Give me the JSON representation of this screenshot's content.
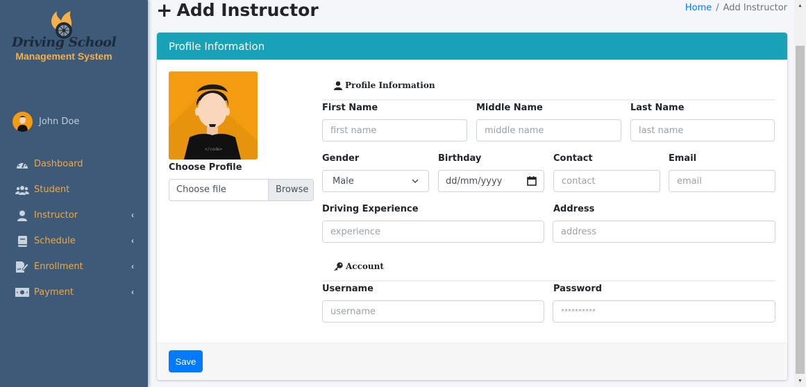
{
  "sidebar": {
    "brand": {
      "title": "Driving School",
      "subtitle": "Management System",
      "logo_icon": "flame-wheel-logo"
    },
    "user": {
      "name": "John Doe",
      "avatar_icon": "user-avatar"
    },
    "items": [
      {
        "label": "Dashboard",
        "icon": "tachometer-icon",
        "has_submenu": false
      },
      {
        "label": "Student",
        "icon": "users-icon",
        "has_submenu": false
      },
      {
        "label": "Instructor",
        "icon": "user-icon",
        "has_submenu": true
      },
      {
        "label": "Schedule",
        "icon": "book-icon",
        "has_submenu": true
      },
      {
        "label": "Enrollment",
        "icon": "file-signature-icon",
        "has_submenu": true
      },
      {
        "label": "Payment",
        "icon": "money-bill-icon",
        "has_submenu": true
      }
    ]
  },
  "header": {
    "title": "Add Instructor",
    "title_icon": "plus-icon",
    "breadcrumb": [
      {
        "label": "Home",
        "link": true
      },
      {
        "label": "Add Instructor",
        "link": false
      }
    ],
    "breadcrumb_separator": "/"
  },
  "card": {
    "header_title": "Profile Information",
    "profile": {
      "choose_label": "Choose Profile",
      "file_placeholder": "Choose file",
      "browse_label": "Browse"
    },
    "sections": {
      "profile_title": "Profile Information",
      "account_title": "Account"
    },
    "fields": {
      "first_name": {
        "label": "First Name",
        "placeholder": "first name",
        "value": ""
      },
      "middle_name": {
        "label": "Middle Name",
        "placeholder": "middle name",
        "value": ""
      },
      "last_name": {
        "label": "Last Name",
        "placeholder": "last name",
        "value": ""
      },
      "gender": {
        "label": "Gender",
        "selected": "Male"
      },
      "birthday": {
        "label": "Birthday",
        "placeholder": "dd/mm/yyyy"
      },
      "contact": {
        "label": "Contact",
        "placeholder": "contact",
        "value": ""
      },
      "email": {
        "label": "Email",
        "placeholder": "email",
        "value": ""
      },
      "experience": {
        "label": "Driving Experience",
        "placeholder": "experience",
        "value": ""
      },
      "address": {
        "label": "Address",
        "placeholder": "address",
        "value": ""
      },
      "username": {
        "label": "Username",
        "placeholder": "username",
        "value": ""
      },
      "password": {
        "label": "Password",
        "placeholder": "**********"
      }
    },
    "footer": {
      "save_label": "Save"
    }
  },
  "colors": {
    "sidebar_bg": "#3d5a78",
    "nav_text": "#f0a845",
    "card_header": "#17a2b8",
    "primary": "#007bff",
    "avatar_bg": "#f39c12"
  }
}
